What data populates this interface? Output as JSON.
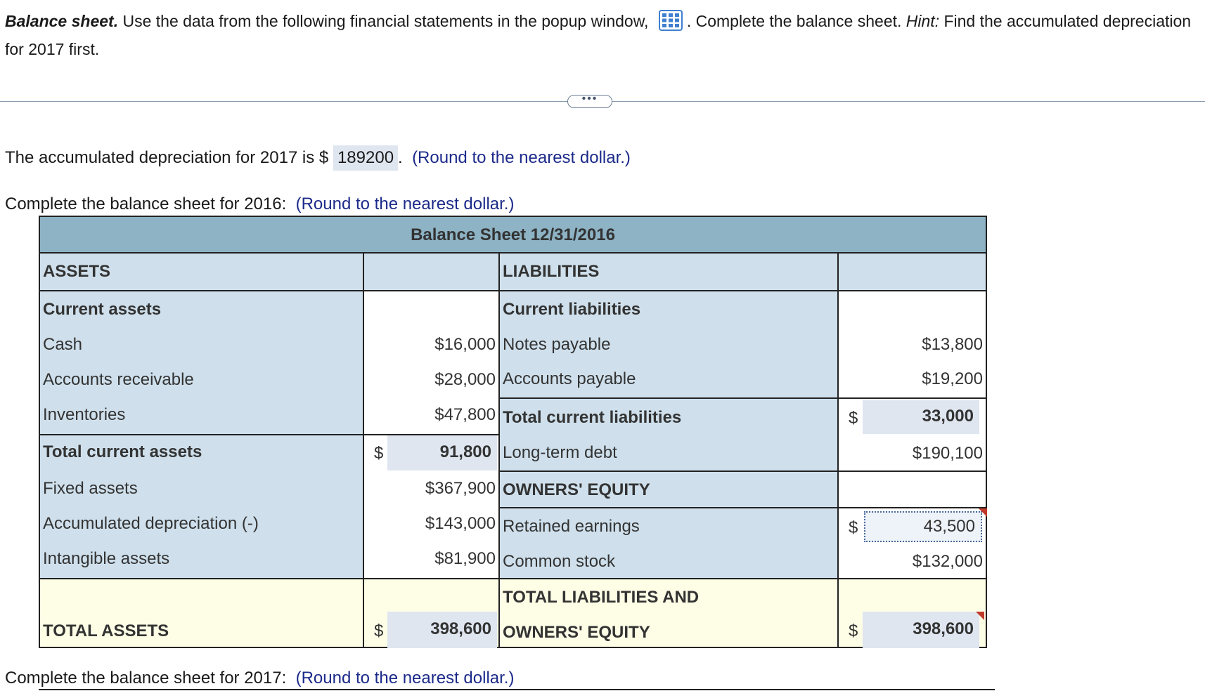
{
  "question": {
    "title": "Balance sheet.",
    "text_a": " Use the data from the following financial statements in the popup window, ",
    "text_b": ". Complete the balance sheet. ",
    "hint_label": "Hint:",
    "hint_text": " Find the accumulated depreciation for 2017 first."
  },
  "more_button": "•••",
  "part1": {
    "prefix": "The accumulated depreciation for 2017 is $",
    "answer": "189200",
    "suffix": ".",
    "round_hint": "(Round to the nearest dollar.)"
  },
  "part2": {
    "prompt": "Complete the balance sheet for 2016:",
    "round_hint": "(Round to the nearest dollar.)"
  },
  "part3": {
    "prompt": "Complete the balance sheet for 2017:",
    "round_hint": "(Round to the nearest dollar.)"
  },
  "sheet": {
    "title": "Balance Sheet 12/31/2016",
    "assets_header": "ASSETS",
    "liabilities_header": "LIABILITIES",
    "current_assets_header": "Current assets",
    "current_liabilities_header": "Current liabilities",
    "cash_label": "Cash",
    "cash_value": "$16,000",
    "ar_label": "Accounts receivable",
    "ar_value": "$28,000",
    "inv_label": "Inventories",
    "inv_value": "$47,800",
    "tca_label": "Total current assets",
    "tca_input": "91,800",
    "fixed_label": "Fixed assets",
    "fixed_value": "$367,900",
    "accdep_label": "Accumulated depreciation (-)",
    "accdep_value": "$143,000",
    "intang_label": "Intangible assets",
    "intang_value": "$81,900",
    "total_assets_label": "TOTAL ASSETS",
    "total_assets_input": "398,600",
    "np_label": "Notes payable",
    "np_value": "$13,800",
    "ap_label": "Accounts payable",
    "ap_value": "$19,200",
    "tcl_label": "Total current liabilities",
    "tcl_input": "33,000",
    "ltd_label": "Long-term debt",
    "ltd_value": "$190,100",
    "oe_header": "OWNERS' EQUITY",
    "re_label": "Retained earnings",
    "re_input": "43,500",
    "cs_label": "Common stock",
    "cs_value": "$132,000",
    "tloe_label_1": "TOTAL LIABILITIES AND",
    "tloe_label_2": "OWNERS' EQUITY",
    "tloe_input": "398,600",
    "currency": "$"
  },
  "colors": {
    "header": "#8db3c4",
    "label_bg": "#cfe0ec",
    "total_bg": "#fefde6",
    "input_bg": "#dfe6f0",
    "hint_text": "#1c2a8a"
  }
}
